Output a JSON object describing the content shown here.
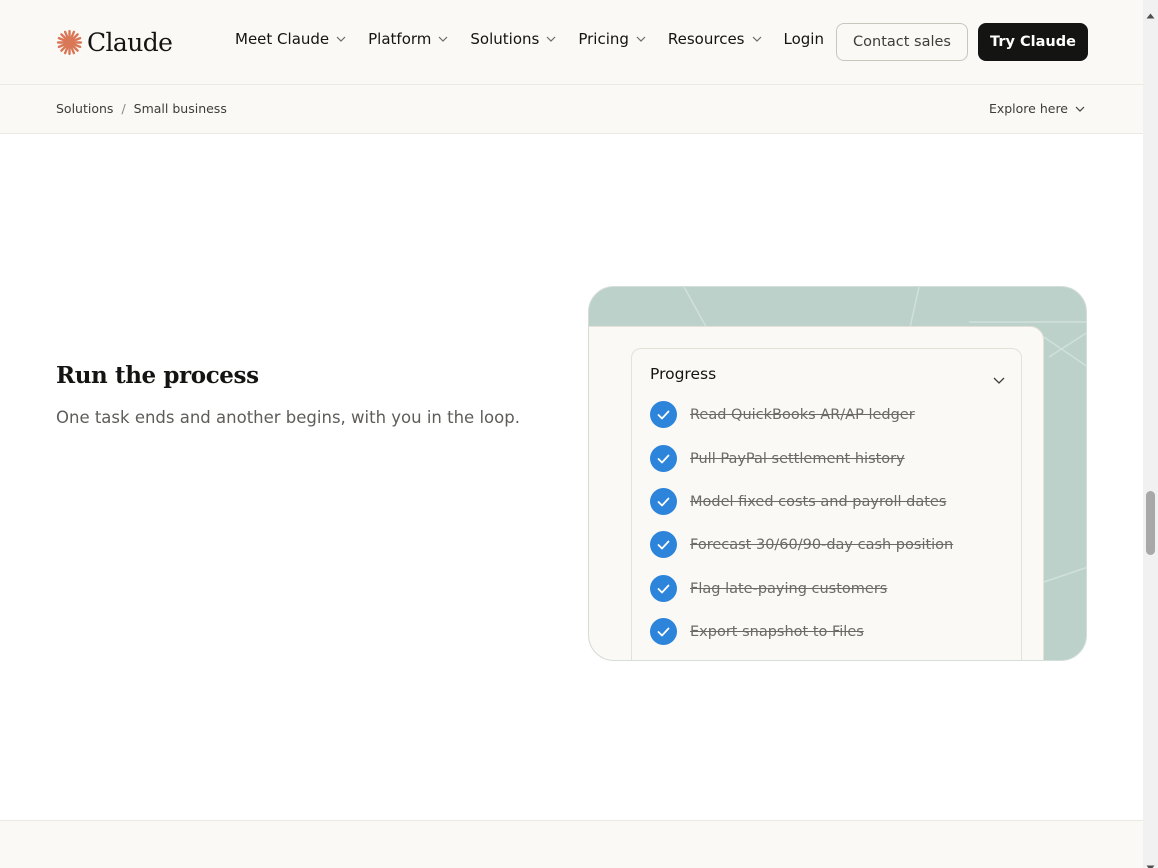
{
  "header": {
    "logo_text": "Claude",
    "logo_color": "#d97757",
    "nav": [
      {
        "label": "Meet Claude",
        "has_dropdown": true
      },
      {
        "label": "Platform",
        "has_dropdown": true
      },
      {
        "label": "Solutions",
        "has_dropdown": true
      },
      {
        "label": "Pricing",
        "has_dropdown": true
      },
      {
        "label": "Resources",
        "has_dropdown": true
      }
    ],
    "login_label": "Login",
    "contact_label": "Contact sales",
    "try_label": "Try Claude"
  },
  "breadcrumb": {
    "items": [
      "Solutions",
      "Small business"
    ],
    "separator": "/",
    "explore_label": "Explore here"
  },
  "section": {
    "title": "Run the process",
    "subtitle": "One task ends and another begins, with you in the loop."
  },
  "progress_card": {
    "heading": "Progress",
    "check_color": "#2c84db",
    "tasks": [
      {
        "label": "Read QuickBooks AR/AP ledger",
        "done": true
      },
      {
        "label": "Pull PayPal settlement history",
        "done": true
      },
      {
        "label": "Model fixed costs and payroll dates",
        "done": true
      },
      {
        "label": "Forecast 30/60/90-day cash position",
        "done": true
      },
      {
        "label": "Flag late-paying customers",
        "done": true
      },
      {
        "label": "Export snapshot to Files",
        "done": true
      }
    ]
  }
}
